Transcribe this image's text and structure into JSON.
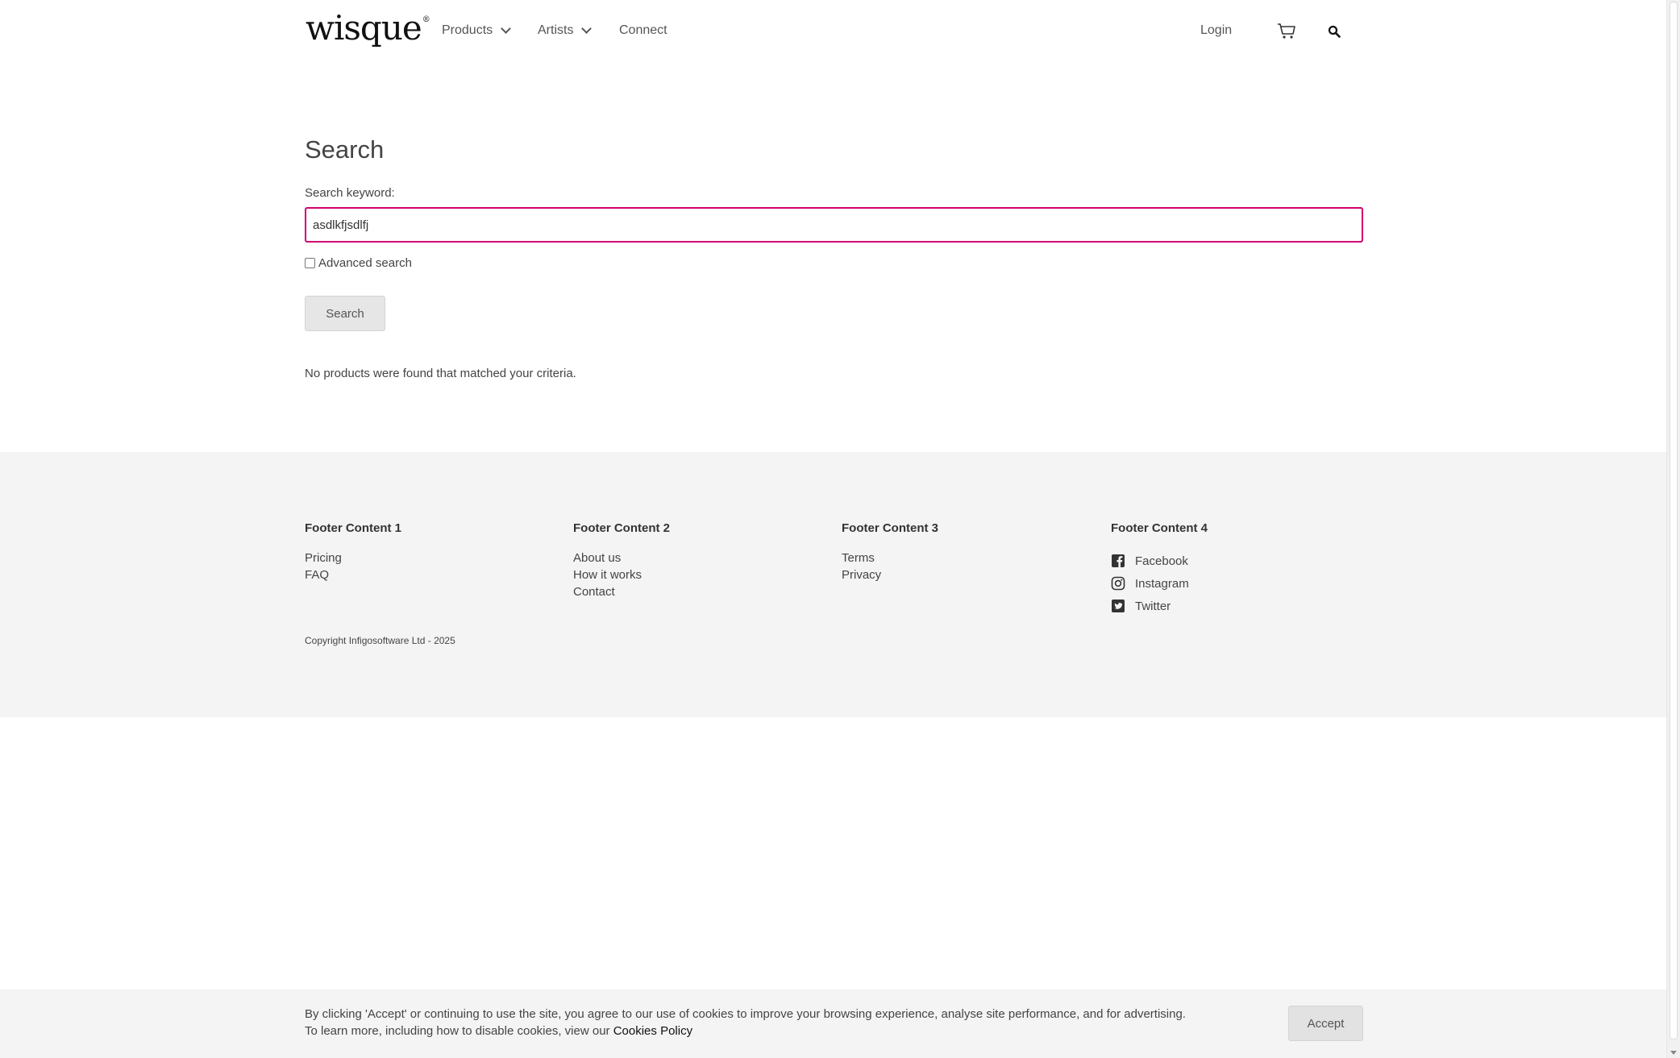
{
  "header": {
    "logo": "wisque",
    "nav": {
      "products": "Products",
      "artists": "Artists",
      "connect": "Connect"
    },
    "login": "Login"
  },
  "main": {
    "title": "Search",
    "keyword_label": "Search keyword:",
    "keyword_value": "asdlkfjsdlfj",
    "advanced_label": "Advanced search",
    "advanced_checked": false,
    "search_button": "Search",
    "no_results": "No products were found that matched your criteria."
  },
  "footer": {
    "columns": [
      {
        "title": "Footer Content 1",
        "links": [
          "Pricing",
          "FAQ"
        ]
      },
      {
        "title": "Footer Content 2",
        "links": [
          "About us",
          "How it works",
          "Contact"
        ]
      },
      {
        "title": "Footer Content 3",
        "links": [
          "Terms",
          "Privacy"
        ]
      },
      {
        "title": "Footer Content 4",
        "social": [
          {
            "label": "Facebook",
            "icon": "facebook-icon"
          },
          {
            "label": "Instagram",
            "icon": "instagram-icon"
          },
          {
            "label": "Twitter",
            "icon": "twitter-icon"
          }
        ]
      }
    ],
    "copyright": "Copyright Infigosoftware Ltd - 2025"
  },
  "cookie": {
    "text_1": "By clicking 'Accept' or continuing to use the site, you agree to our use of cookies to improve your browsing experience, analyse site performance, and for advertising.",
    "text_2": "To learn more, including how to disable cookies, view our",
    "policy_link": "Cookies Policy",
    "accept_button": "Accept"
  },
  "colors": {
    "accent": "#d2006f",
    "footer_bg": "#f4f4f4",
    "button_bg": "#e6e6e6"
  }
}
